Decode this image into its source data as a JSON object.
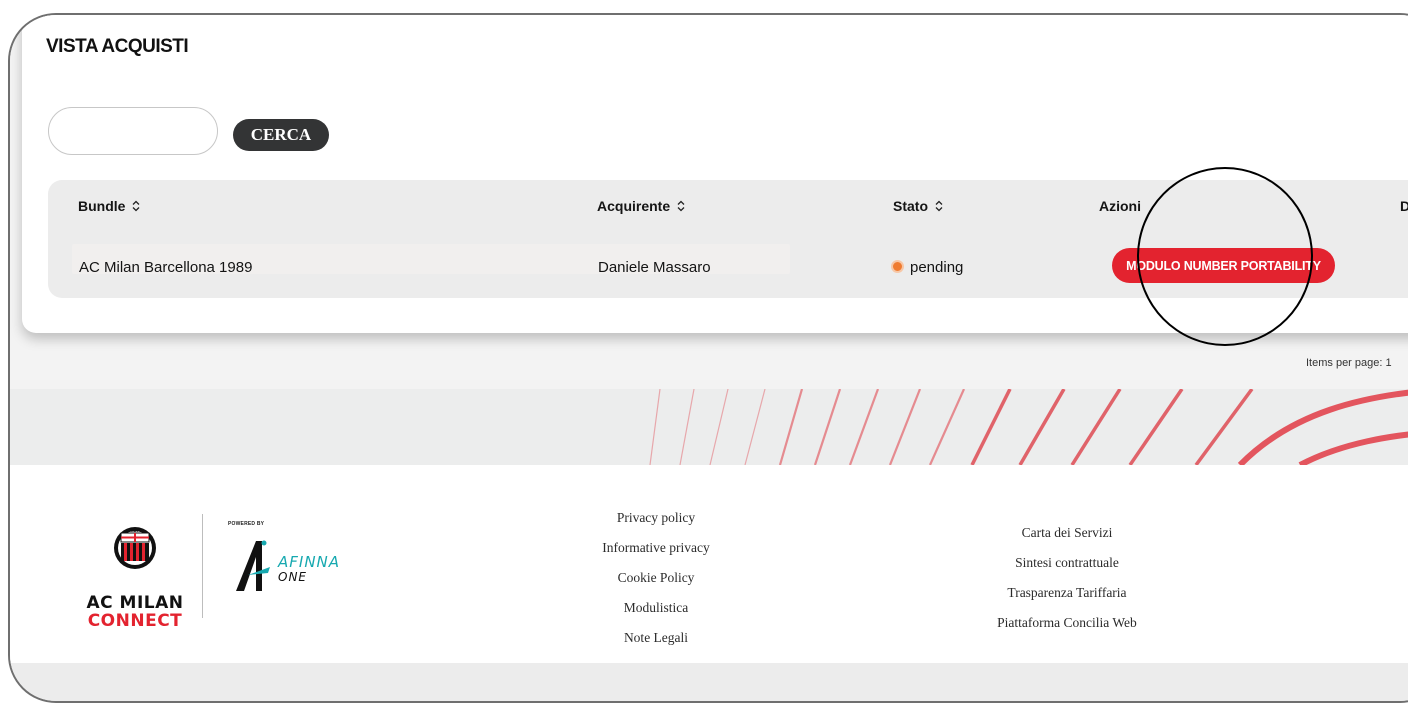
{
  "page": {
    "title": "VISTA ACQUISTI"
  },
  "search": {
    "value": "",
    "placeholder": "",
    "button_label": "CERCA"
  },
  "table": {
    "columns": [
      {
        "label": "Bundle",
        "sortable": true
      },
      {
        "label": "Acquirente",
        "sortable": true
      },
      {
        "label": "Stato",
        "sortable": true
      },
      {
        "label": "Azioni",
        "sortable": false
      },
      {
        "label": "Do",
        "sortable": false
      }
    ],
    "rows": [
      {
        "bundle": "AC Milan Barcellona 1989",
        "buyer": "Daniele Massaro",
        "status": "pending",
        "action_label": "MODULO NUMBER PORTABILITY"
      }
    ]
  },
  "pagination": {
    "items_per_page_label": "Items per page: 1"
  },
  "footer": {
    "brand": {
      "line1": "AC MILAN",
      "line2": "CONNECT",
      "crest_text": "ACM"
    },
    "partner": {
      "powered_by": "POWERED BY",
      "name": "AFINNA",
      "sub": "ONE"
    },
    "links_left": [
      "Privacy policy",
      "Informative privacy",
      "Cookie Policy",
      "Modulistica",
      "Note Legali"
    ],
    "links_right": [
      "Carta dei Servizi",
      "Sintesi contrattuale",
      "Trasparenza Tariffaria",
      "Piattaforma Concilia Web"
    ]
  },
  "colors": {
    "accent": "#e3232f",
    "dark_button": "#333435",
    "status_pending": "#ef7b30",
    "partner_teal": "#17a9b0"
  },
  "icons": {
    "sort": "sort-arrows-icon",
    "status": "status-dot-icon",
    "brand": "ac-milan-crest-icon",
    "partner": "afinna-logo-icon"
  }
}
